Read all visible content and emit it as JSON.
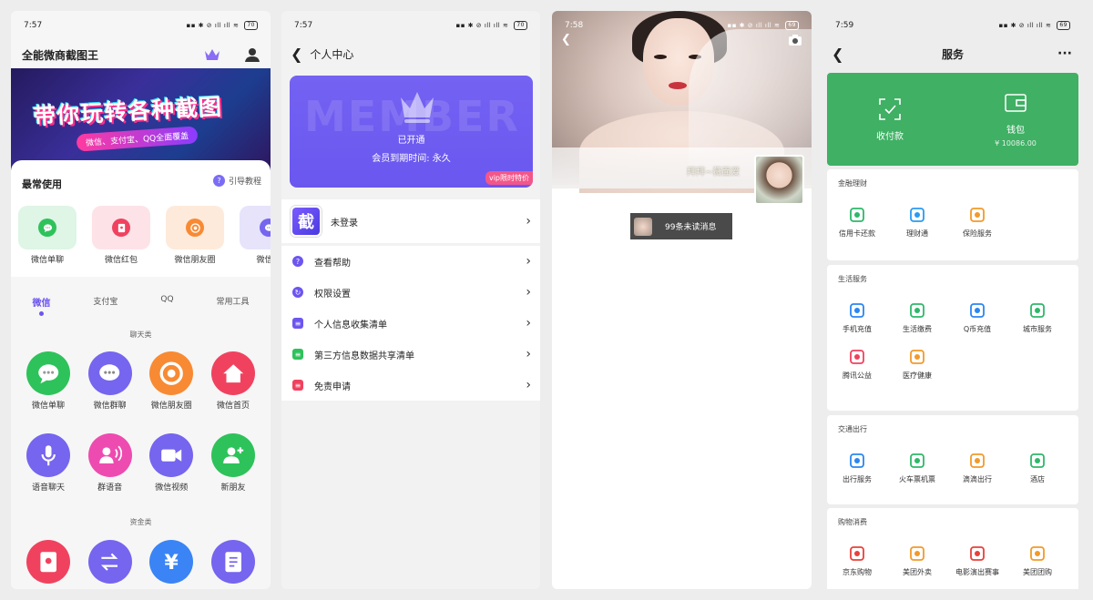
{
  "phone1": {
    "time": "7:57",
    "battery": "70",
    "app_title": "全能微商截图王",
    "banner_title": "带你玩转各种截图",
    "banner_sub": "微信、支付宝、QQ全面覆盖",
    "most_used": "最常使用",
    "guide": "引导教程",
    "quick": [
      {
        "label": "微信单聊",
        "icon": "chat-bubble-icon",
        "bg": "#dff5e6",
        "color": "#2ec25b"
      },
      {
        "label": "微信红包",
        "icon": "red-envelope-icon",
        "bg": "#fde3e8",
        "color": "#f0425f"
      },
      {
        "label": "微信朋友圈",
        "icon": "moments-icon",
        "bg": "#feeadb",
        "color": "#f88a33"
      },
      {
        "label": "微信群",
        "icon": "group-chat-icon",
        "bg": "#e6e3fb",
        "color": "#7565ef"
      }
    ],
    "tabs": [
      "微信",
      "支付宝",
      "QQ",
      "常用工具"
    ],
    "cat_chat": "聊天类",
    "chat_items": [
      {
        "label": "微信单聊",
        "icon": "chat-bubble-icon",
        "color": "#2ec25b"
      },
      {
        "label": "微信群聊",
        "icon": "group-chat-icon",
        "color": "#7565ef"
      },
      {
        "label": "微信朋友圈",
        "icon": "moments-icon",
        "color": "#f88a33"
      },
      {
        "label": "微信首页",
        "icon": "home-icon",
        "color": "#f0425f"
      }
    ],
    "chat_items2": [
      {
        "label": "语音聊天",
        "icon": "microphone-icon",
        "color": "#7565ef"
      },
      {
        "label": "群语音",
        "icon": "group-voice-icon",
        "color": "#ee4bb0"
      },
      {
        "label": "微信视频",
        "icon": "video-icon",
        "color": "#7565ef"
      },
      {
        "label": "新朋友",
        "icon": "add-friend-icon",
        "color": "#2ec25b"
      }
    ],
    "cat_money": "资金类",
    "money_items": [
      {
        "icon": "red-envelope-icon",
        "color": "#f0425f"
      },
      {
        "icon": "transfer-icon",
        "color": "#7565ef"
      },
      {
        "icon": "yuan-icon",
        "color": "#3a84f5"
      },
      {
        "icon": "bill-icon",
        "color": "#7565ef"
      }
    ]
  },
  "phone2": {
    "time": "7:57",
    "battery": "70",
    "title": "个人中心",
    "watermark": "MEMBER",
    "status": "已开通",
    "expire": "会员到期时间: 永久",
    "vip_tag": "vip限时特价",
    "login_logo": "截",
    "login": "未登录",
    "menu": [
      {
        "label": "查看帮助",
        "icon": "help-icon",
        "color": "#6c55f0"
      },
      {
        "label": "权限设置",
        "icon": "permission-icon",
        "color": "#6c55f0"
      },
      {
        "label": "个人信息收集清单",
        "icon": "list-icon",
        "color": "#6c55f0"
      },
      {
        "label": "第三方信息数据共享清单",
        "icon": "share-list-icon",
        "color": "#2ec25b"
      },
      {
        "label": "免责申请",
        "icon": "disclaimer-icon",
        "color": "#f0425f"
      }
    ]
  },
  "phone3": {
    "time": "7:58",
    "battery": "69",
    "nickname": "拜拜~薇面爱",
    "unread": "99条未读消息"
  },
  "phone4": {
    "time": "7:59",
    "battery": "69",
    "title": "服务",
    "pay": "收付款",
    "wallet": "钱包",
    "balance": "¥ 10086.00",
    "finance_title": "金融理财",
    "finance": [
      {
        "label": "信用卡还款",
        "icon": "credit-card-icon",
        "color": "#2eb86a"
      },
      {
        "label": "理财通",
        "icon": "wealth-icon",
        "color": "#2a9af2"
      },
      {
        "label": "保险服务",
        "icon": "insurance-icon",
        "color": "#f29a2a"
      }
    ],
    "life_title": "生活服务",
    "life": [
      {
        "label": "手机充值",
        "icon": "phone-recharge-icon",
        "color": "#2a86f2"
      },
      {
        "label": "生活缴费",
        "icon": "utility-icon",
        "color": "#2eb86a"
      },
      {
        "label": "Q币充值",
        "icon": "qq-coin-icon",
        "color": "#2a86f2"
      },
      {
        "label": "城市服务",
        "icon": "city-icon",
        "color": "#2eb86a"
      }
    ],
    "life2": [
      {
        "label": "腾讯公益",
        "icon": "charity-icon",
        "color": "#f0425f"
      },
      {
        "label": "医疗健康",
        "icon": "medical-icon",
        "color": "#f29a2a"
      }
    ],
    "travel_title": "交通出行",
    "travel": [
      {
        "label": "出行服务",
        "icon": "travel-icon",
        "color": "#2a86f2"
      },
      {
        "label": "火车票机票",
        "icon": "train-icon",
        "color": "#2eb86a"
      },
      {
        "label": "滴滴出行",
        "icon": "didi-icon",
        "color": "#f29a2a"
      },
      {
        "label": "酒店",
        "icon": "hotel-icon",
        "color": "#2eb86a"
      }
    ],
    "shop_title": "购物消费",
    "shop": [
      {
        "label": "京东购物",
        "icon": "jd-icon",
        "color": "#e8403a"
      },
      {
        "label": "美团外卖",
        "icon": "meituan-delivery-icon",
        "color": "#f29a2a"
      },
      {
        "label": "电影演出赛事",
        "icon": "movie-icon",
        "color": "#e8403a"
      },
      {
        "label": "美团团购",
        "icon": "meituan-group-icon",
        "color": "#f29a2a"
      }
    ]
  }
}
